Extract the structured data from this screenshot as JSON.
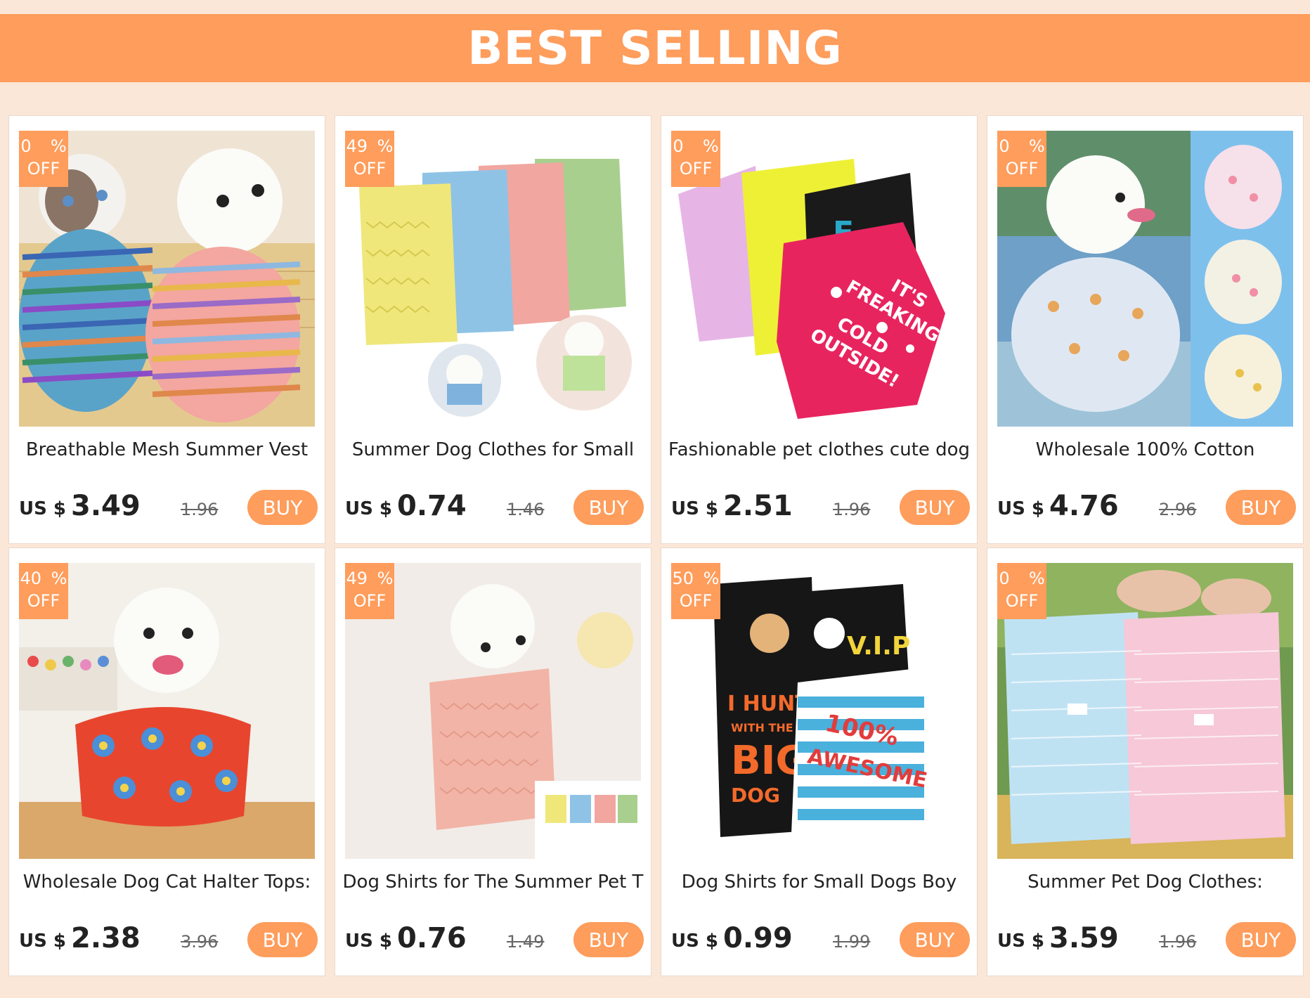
{
  "banner": {
    "title": "BEST SELLING"
  },
  "colors": {
    "accent": "#fe9d5c",
    "page_bg": "#fbe7d8",
    "card_bg": "#ffffff"
  },
  "products": [
    {
      "discount": "0  %",
      "off": "OFF",
      "title": "Breathable Mesh Summer Vest",
      "currency": "US $",
      "price": "3.49",
      "old_price": "1.96",
      "buy": "BUY",
      "image": "cat-and-dog-in-striped-vests"
    },
    {
      "discount": "49 %",
      "off": "OFF",
      "title": "Summer Dog Clothes for Small",
      "currency": "US $",
      "price": "0.74",
      "old_price": "1.46",
      "buy": "BUY",
      "image": "four-pastel-mesh-dog-vests"
    },
    {
      "discount": "0  %",
      "off": "OFF",
      "title": "Fashionable pet clothes cute dog",
      "currency": "US $",
      "price": "2.51",
      "old_price": "1.96",
      "buy": "BUY",
      "image": "printed-dog-t-shirts",
      "image_text": [
        "IT'S",
        "FREAKING",
        "COLD",
        "OUTSIDE!"
      ]
    },
    {
      "discount": "0  %",
      "off": "OFF",
      "title": "Wholesale 100% Cotton",
      "currency": "US $",
      "price": "4.76",
      "old_price": "2.96",
      "buy": "BUY",
      "image": "dog-in-floral-cotton-vest"
    },
    {
      "discount": "40 %",
      "off": "OFF",
      "title": "Wholesale Dog Cat Halter Tops:",
      "currency": "US $",
      "price": "2.38",
      "old_price": "3.96",
      "buy": "BUY",
      "image": "dog-in-red-flower-halter-top"
    },
    {
      "discount": "49 %",
      "off": "OFF",
      "title": "Dog Shirts for The Summer Pet T",
      "currency": "US $",
      "price": "0.76",
      "old_price": "1.49",
      "buy": "BUY",
      "image": "poodle-in-pink-vest"
    },
    {
      "discount": "50 %",
      "off": "OFF",
      "title": "Dog Shirts for Small Dogs Boy",
      "currency": "US $",
      "price": "0.99",
      "old_price": "1.99",
      "buy": "BUY",
      "image": "black-graphic-dog-shirts",
      "image_text": [
        "I HUNT",
        "WITH THE",
        "BIG",
        "DOG",
        "V.I.P",
        "100%",
        "AWESOME"
      ]
    },
    {
      "discount": "0  %",
      "off": "OFF",
      "title": "Summer Pet Dog Clothes:",
      "currency": "US $",
      "price": "3.59",
      "old_price": "1.96",
      "buy": "BUY",
      "image": "blue-and-pink-lace-shirts"
    }
  ]
}
